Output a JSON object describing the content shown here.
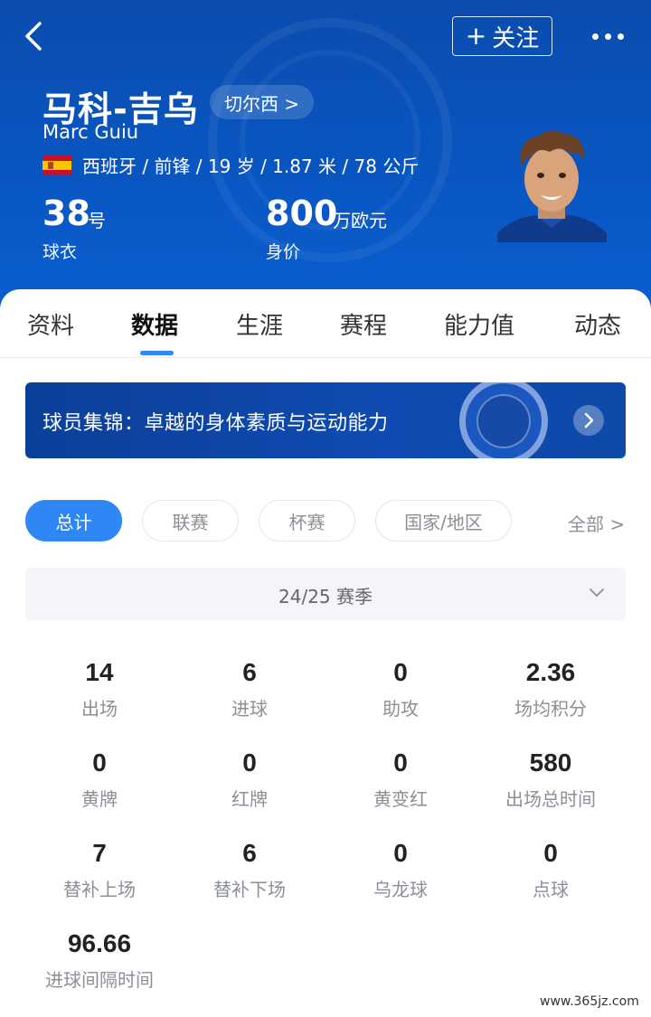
{
  "header": {
    "follow_label": "关注",
    "player_name": "马科-吉乌",
    "club_link": "切尔西 >",
    "english_name": "Marc Guiu",
    "info_line": "西班牙 / 前锋 / 19 岁 / 1.87 米 / 78 公斤",
    "jersey_number": "38",
    "jersey_unit": "号",
    "jersey_label": "球衣",
    "value_number": "800",
    "value_unit": "万欧元",
    "value_label": "身价"
  },
  "tabs": [
    "资料",
    "数据",
    "生涯",
    "赛程",
    "能力值",
    "动态"
  ],
  "active_tab": "数据",
  "banner": {
    "text": "球员集锦：卓越的身体素质与运动能力"
  },
  "filters": {
    "pills": [
      "总计",
      "联赛",
      "杯赛",
      "国家/地区"
    ],
    "active": "总计",
    "all_label": "全部 >"
  },
  "season": {
    "label": "24/25 赛季"
  },
  "stats": [
    {
      "value": "14",
      "label": "出场"
    },
    {
      "value": "6",
      "label": "进球"
    },
    {
      "value": "0",
      "label": "助攻"
    },
    {
      "value": "2.36",
      "label": "场均积分"
    },
    {
      "value": "0",
      "label": "黄牌"
    },
    {
      "value": "0",
      "label": "红牌"
    },
    {
      "value": "0",
      "label": "黄变红"
    },
    {
      "value": "580",
      "label": "出场总时间"
    },
    {
      "value": "7",
      "label": "替补上场"
    },
    {
      "value": "6",
      "label": "替补下场"
    },
    {
      "value": "0",
      "label": "乌龙球"
    },
    {
      "value": "0",
      "label": "点球"
    },
    {
      "value": "96.66",
      "label": "进球间隔时间"
    }
  ],
  "watermark": "www.365jz.com",
  "colors": {
    "header_blue": "#0957c4",
    "accent": "#2f87f5"
  },
  "icons": [
    "back-arrow-icon",
    "plus-icon",
    "more-dots-icon",
    "spain-flag-icon",
    "chelsea-crest-icon",
    "chevron-right-icon",
    "chevron-down-icon"
  ]
}
